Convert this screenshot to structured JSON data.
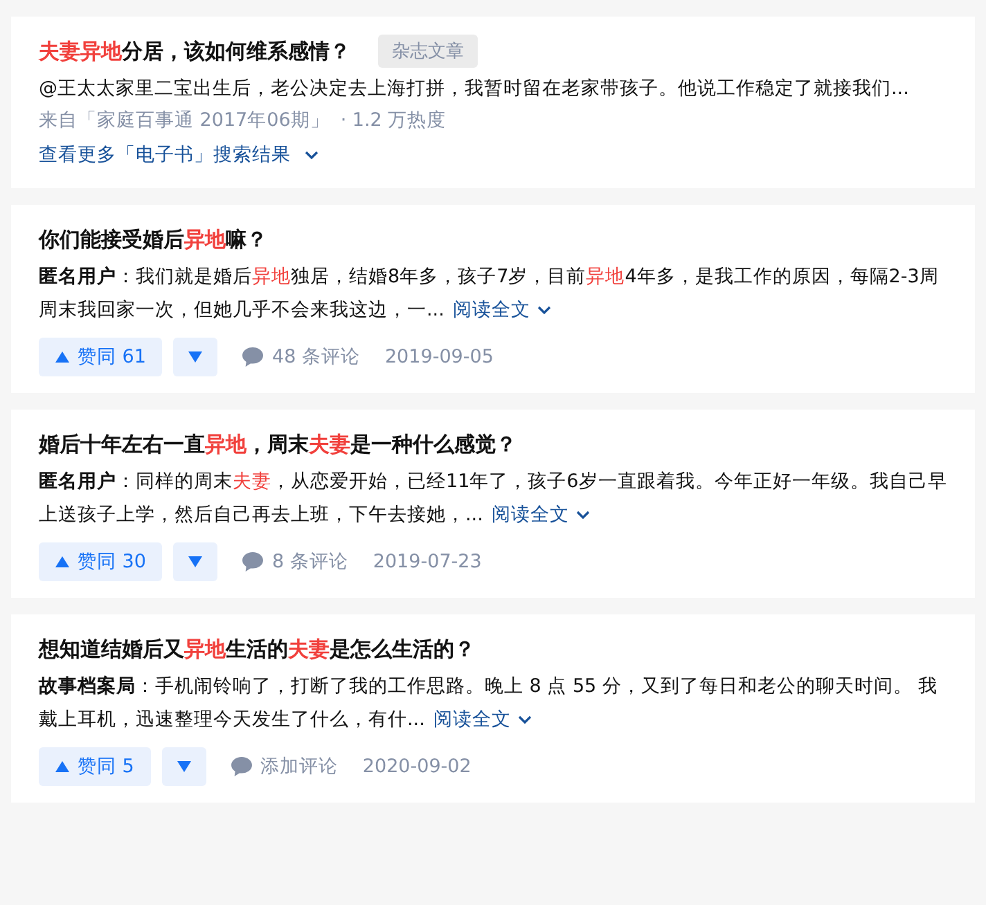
{
  "results": [
    {
      "kind": "ebook",
      "title": [
        {
          "text": "夫妻异地",
          "hl": true
        },
        {
          "text": "分居，该如何维系感情？",
          "hl": false
        }
      ],
      "tag": "杂志文章",
      "excerpt": [
        {
          "text": "@王太太家里二宝出生后，老公决定去上海打拼，我暂时留在老家带孩子。他说工作稳定了就接我们...",
          "hl": false
        }
      ],
      "source": "来自「家庭百事通 2017年06期」",
      "heat": "· 1.2 万热度",
      "more_link": "查看更多「电子书」搜索结果"
    },
    {
      "kind": "answer",
      "title": [
        {
          "text": "你们能接受婚后",
          "hl": false
        },
        {
          "text": "异地",
          "hl": true
        },
        {
          "text": "嘛？",
          "hl": false
        }
      ],
      "author": "匿名用户",
      "excerpt": [
        {
          "text": "：我们就是婚后",
          "hl": false
        },
        {
          "text": "异地",
          "hl": true
        },
        {
          "text": "独居，结婚8年多，孩子7岁，目前",
          "hl": false
        },
        {
          "text": "异地",
          "hl": true
        },
        {
          "text": "4年多，是我工作的原因，每隔2-3周周末我回家一次，但她几乎不会来我这边，一...",
          "hl": false
        }
      ],
      "read_more": "阅读全文",
      "upvote": "赞同 61",
      "comments": "48 条评论",
      "date": "2019-09-05"
    },
    {
      "kind": "answer",
      "title": [
        {
          "text": "婚后十年左右一直",
          "hl": false
        },
        {
          "text": "异地",
          "hl": true
        },
        {
          "text": "，周末",
          "hl": false
        },
        {
          "text": "夫妻",
          "hl": true
        },
        {
          "text": "是一种什么感觉？",
          "hl": false
        }
      ],
      "author": "匿名用户",
      "excerpt": [
        {
          "text": "：同样的周末",
          "hl": false
        },
        {
          "text": "夫妻",
          "hl": true
        },
        {
          "text": "，从恋爱开始，已经11年了，孩子6岁一直跟着我。今年正好一年级。我自己早上送孩子上学，然后自己再去上班，下午去接她，...",
          "hl": false
        }
      ],
      "read_more": "阅读全文",
      "upvote": "赞同 30",
      "comments": "8 条评论",
      "date": "2019-07-23"
    },
    {
      "kind": "answer",
      "title": [
        {
          "text": "想知道结婚后又",
          "hl": false
        },
        {
          "text": "异地",
          "hl": true
        },
        {
          "text": "生活的",
          "hl": false
        },
        {
          "text": "夫妻",
          "hl": true
        },
        {
          "text": "是怎么生活的？",
          "hl": false
        }
      ],
      "author": "故事档案局",
      "excerpt": [
        {
          "text": "：手机闹铃响了，打断了我的工作思路。晚上 8 点 55 分，又到了每日和老公的聊天时间。 我戴上耳机，迅速整理今天发生了什么，有什...",
          "hl": false
        }
      ],
      "read_more": "阅读全文",
      "upvote": "赞同 5",
      "comments": "添加评论",
      "date": "2020-09-02"
    }
  ]
}
